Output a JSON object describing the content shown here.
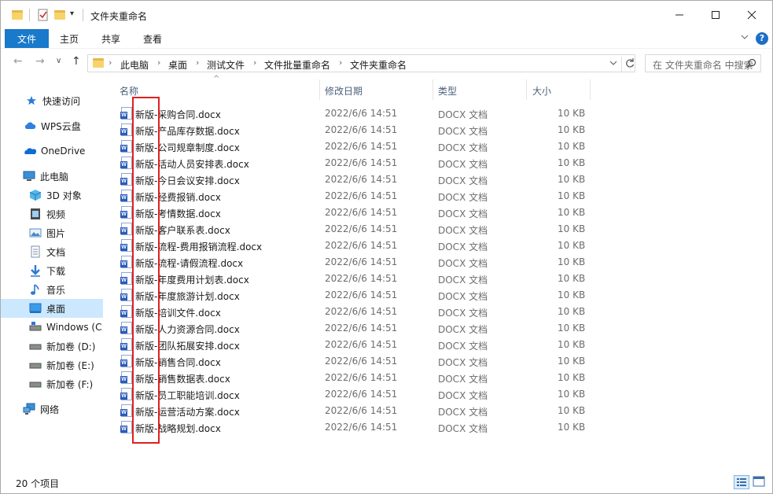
{
  "title_bar": {
    "title": "文件夹重命名",
    "quick_access_icons": [
      "folder-icon",
      "properties-icon",
      "new-folder-icon"
    ],
    "minimize_label": "—",
    "maximize_label": "☐",
    "close_label": "✕"
  },
  "ribbon": {
    "tabs": [
      {
        "label": "文件",
        "active": true
      },
      {
        "label": "主页"
      },
      {
        "label": "共享"
      },
      {
        "label": "查看"
      }
    ],
    "help": "?"
  },
  "navigation": {
    "back": "←",
    "forward": "→",
    "recent": "∨",
    "up": "↑",
    "breadcrumb": [
      "此电脑",
      "桌面",
      "测试文件",
      "文件批量重命名",
      "文件夹重命名"
    ],
    "search_placeholder": "在 文件夹重命名 中搜索"
  },
  "nav_pane": {
    "items": [
      {
        "label": "快速访问",
        "icon": "star-icon"
      },
      {
        "label": "WPS云盘",
        "icon": "wps-cloud-icon"
      },
      {
        "label": "OneDrive",
        "icon": "onedrive-icon"
      },
      {
        "label": "此电脑",
        "icon": "computer-icon"
      },
      {
        "label": "3D 对象",
        "icon": "3d-objects-icon"
      },
      {
        "label": "视频",
        "icon": "video-icon"
      },
      {
        "label": "图片",
        "icon": "pictures-icon"
      },
      {
        "label": "文档",
        "icon": "documents-icon"
      },
      {
        "label": "下载",
        "icon": "download-icon"
      },
      {
        "label": "音乐",
        "icon": "music-icon"
      },
      {
        "label": "桌面",
        "icon": "desktop-icon",
        "selected": true
      },
      {
        "label": "Windows (C:",
        "icon": "drive-c-icon"
      },
      {
        "label": "新加卷 (D:)",
        "icon": "drive-icon"
      },
      {
        "label": "新加卷 (E:)",
        "icon": "drive-icon"
      },
      {
        "label": "新加卷 (F:)",
        "icon": "drive-icon"
      },
      {
        "label": "网络",
        "icon": "network-icon"
      }
    ]
  },
  "columns": {
    "name": "名称",
    "date": "修改日期",
    "type": "类型",
    "size": "大小"
  },
  "files": [
    {
      "name": "新版-采购合同.docx",
      "date": "2022/6/6 14:51",
      "type": "DOCX 文档",
      "size": "10 KB"
    },
    {
      "name": "新版-产品库存数据.docx",
      "date": "2022/6/6 14:51",
      "type": "DOCX 文档",
      "size": "10 KB"
    },
    {
      "name": "新版-公司规章制度.docx",
      "date": "2022/6/6 14:51",
      "type": "DOCX 文档",
      "size": "10 KB"
    },
    {
      "name": "新版-活动人员安排表.docx",
      "date": "2022/6/6 14:51",
      "type": "DOCX 文档",
      "size": "10 KB"
    },
    {
      "name": "新版-今日会议安排.docx",
      "date": "2022/6/6 14:51",
      "type": "DOCX 文档",
      "size": "10 KB"
    },
    {
      "name": "新版-经费报销.docx",
      "date": "2022/6/6 14:51",
      "type": "DOCX 文档",
      "size": "10 KB"
    },
    {
      "name": "新版-考情数据.docx",
      "date": "2022/6/6 14:51",
      "type": "DOCX 文档",
      "size": "10 KB"
    },
    {
      "name": "新版-客户联系表.docx",
      "date": "2022/6/6 14:51",
      "type": "DOCX 文档",
      "size": "10 KB"
    },
    {
      "name": "新版-流程-费用报销流程.docx",
      "date": "2022/6/6 14:51",
      "type": "DOCX 文档",
      "size": "10 KB"
    },
    {
      "name": "新版-流程-请假流程.docx",
      "date": "2022/6/6 14:51",
      "type": "DOCX 文档",
      "size": "10 KB"
    },
    {
      "name": "新版-年度费用计划表.docx",
      "date": "2022/6/6 14:51",
      "type": "DOCX 文档",
      "size": "10 KB"
    },
    {
      "name": "新版-年度旅游计划.docx",
      "date": "2022/6/6 14:51",
      "type": "DOCX 文档",
      "size": "10 KB"
    },
    {
      "name": "新版-培训文件.docx",
      "date": "2022/6/6 14:51",
      "type": "DOCX 文档",
      "size": "10 KB"
    },
    {
      "name": "新版-人力资源合同.docx",
      "date": "2022/6/6 14:51",
      "type": "DOCX 文档",
      "size": "10 KB"
    },
    {
      "name": "新版-团队拓展安排.docx",
      "date": "2022/6/6 14:51",
      "type": "DOCX 文档",
      "size": "10 KB"
    },
    {
      "name": "新版-销售合同.docx",
      "date": "2022/6/6 14:51",
      "type": "DOCX 文档",
      "size": "10 KB"
    },
    {
      "name": "新版-销售数据表.docx",
      "date": "2022/6/6 14:51",
      "type": "DOCX 文档",
      "size": "10 KB"
    },
    {
      "name": "新版-员工职能培训.docx",
      "date": "2022/6/6 14:51",
      "type": "DOCX 文档",
      "size": "10 KB"
    },
    {
      "name": "新版-运营活动方案.docx",
      "date": "2022/6/6 14:51",
      "type": "DOCX 文档",
      "size": "10 KB"
    },
    {
      "name": "新版-战略规划.docx",
      "date": "2022/6/6 14:51",
      "type": "DOCX 文档",
      "size": "10 KB"
    }
  ],
  "status": {
    "item_count": "20 个项目"
  },
  "colors": {
    "file_tab": "#1979ca",
    "selection": "#cce8ff",
    "annotation_box": "#e02020"
  }
}
